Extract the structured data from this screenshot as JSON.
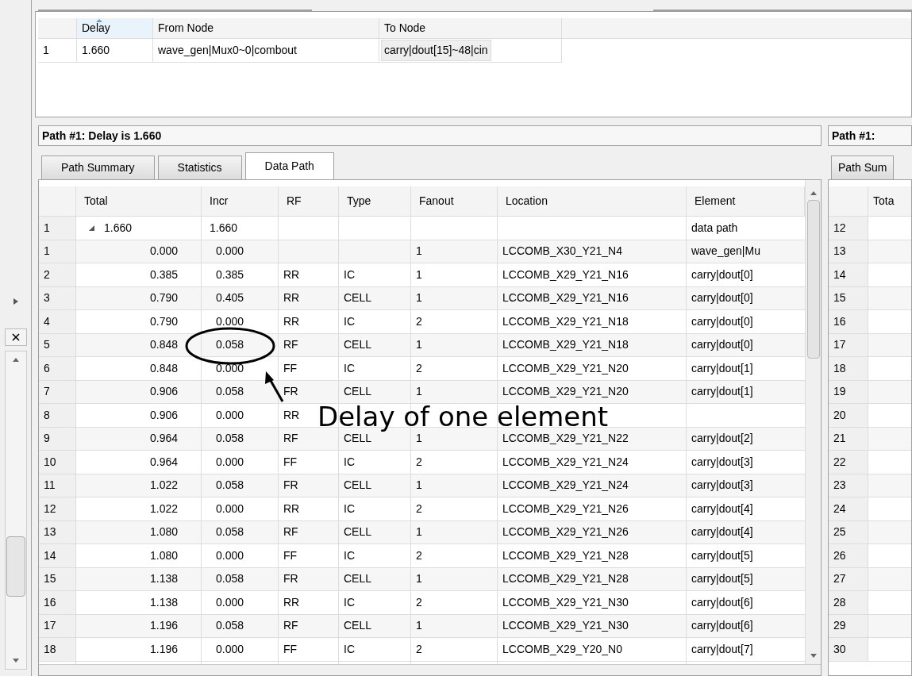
{
  "top_table": {
    "columns": [
      {
        "sorted": false
      },
      {
        "label": "Delay",
        "sorted": true
      },
      {
        "label": "From Node",
        "sorted": false
      },
      {
        "label": "To Node",
        "sorted": false
      }
    ],
    "rows": [
      {
        "cells": [
          "1",
          "1.660",
          "wave_gen|Mux0~0|combout",
          "carry|dout[15]~48|cin"
        ]
      }
    ]
  },
  "path_panel": {
    "title": "Path #1: Delay is 1.660",
    "tabs": [
      {
        "label": "Path Summary",
        "selected": false
      },
      {
        "label": "Statistics",
        "selected": false
      },
      {
        "label": "Data Path",
        "selected": true
      }
    ],
    "columns": [
      "Total",
      "Incr",
      "RF",
      "Type",
      "Fanout",
      "Location",
      "Element"
    ],
    "rows": [
      {
        "num": "1",
        "total": "1.660",
        "incr": "1.660",
        "element": "data path",
        "expanded": true,
        "children": [
          {
            "num": "1",
            "total": "0.000",
            "incr": "0.000",
            "fanout": "1",
            "location": "LCCOMB_X30_Y21_N4",
            "element": "wave_gen|Mu"
          },
          {
            "num": "2",
            "total": "0.385",
            "incr": "0.385",
            "rf": "RR",
            "type": "IC",
            "fanout": "1",
            "location": "LCCOMB_X29_Y21_N16",
            "element": "carry|dout[0]"
          },
          {
            "num": "3",
            "total": "0.790",
            "incr": "0.405",
            "rf": "RR",
            "type": "CELL",
            "fanout": "1",
            "location": "LCCOMB_X29_Y21_N16",
            "element": "carry|dout[0]"
          },
          {
            "num": "4",
            "total": "0.790",
            "incr": "0.000",
            "rf": "RR",
            "type": "IC",
            "fanout": "2",
            "location": "LCCOMB_X29_Y21_N18",
            "element": "carry|dout[0]"
          },
          {
            "num": "5",
            "total": "0.848",
            "incr": "0.058",
            "rf": "RF",
            "type": "CELL",
            "fanout": "1",
            "location": "LCCOMB_X29_Y21_N18",
            "element": "carry|dout[0]"
          },
          {
            "num": "6",
            "total": "0.848",
            "incr": "0.000",
            "rf": "FF",
            "type": "IC",
            "fanout": "2",
            "location": "LCCOMB_X29_Y21_N20",
            "element": "carry|dout[1]"
          },
          {
            "num": "7",
            "total": "0.906",
            "incr": "0.058",
            "rf": "FR",
            "type": "CELL",
            "fanout": "1",
            "location": "LCCOMB_X29_Y21_N20",
            "element": "carry|dout[1]"
          },
          {
            "num": "8",
            "total": "0.906",
            "incr": "0.000",
            "rf": "RR"
          },
          {
            "num": "9",
            "total": "0.964",
            "incr": "0.058",
            "rf": "RF",
            "type": "CELL",
            "fanout": "1",
            "location": "LCCOMB_X29_Y21_N22",
            "element": "carry|dout[2]"
          },
          {
            "num": "10",
            "total": "0.964",
            "incr": "0.000",
            "rf": "FF",
            "type": "IC",
            "fanout": "2",
            "location": "LCCOMB_X29_Y21_N24",
            "element": "carry|dout[3]"
          },
          {
            "num": "11",
            "total": "1.022",
            "incr": "0.058",
            "rf": "FR",
            "type": "CELL",
            "fanout": "1",
            "location": "LCCOMB_X29_Y21_N24",
            "element": "carry|dout[3]"
          },
          {
            "num": "12",
            "total": "1.022",
            "incr": "0.000",
            "rf": "RR",
            "type": "IC",
            "fanout": "2",
            "location": "LCCOMB_X29_Y21_N26",
            "element": "carry|dout[4]"
          },
          {
            "num": "13",
            "total": "1.080",
            "incr": "0.058",
            "rf": "RF",
            "type": "CELL",
            "fanout": "1",
            "location": "LCCOMB_X29_Y21_N26",
            "element": "carry|dout[4]"
          },
          {
            "num": "14",
            "total": "1.080",
            "incr": "0.000",
            "rf": "FF",
            "type": "IC",
            "fanout": "2",
            "location": "LCCOMB_X29_Y21_N28",
            "element": "carry|dout[5]"
          },
          {
            "num": "15",
            "total": "1.138",
            "incr": "0.058",
            "rf": "FR",
            "type": "CELL",
            "fanout": "1",
            "location": "LCCOMB_X29_Y21_N28",
            "element": "carry|dout[5]"
          },
          {
            "num": "16",
            "total": "1.138",
            "incr": "0.000",
            "rf": "RR",
            "type": "IC",
            "fanout": "2",
            "location": "LCCOMB_X29_Y21_N30",
            "element": "carry|dout[6]"
          },
          {
            "num": "17",
            "total": "1.196",
            "incr": "0.058",
            "rf": "RF",
            "type": "CELL",
            "fanout": "1",
            "location": "LCCOMB_X29_Y21_N30",
            "element": "carry|dout[6]"
          },
          {
            "num": "18",
            "total": "1.196",
            "incr": "0.000",
            "rf": "FF",
            "type": "IC",
            "fanout": "2",
            "location": "LCCOMB_X29_Y20_N0",
            "element": "carry|dout[7]"
          }
        ]
      }
    ]
  },
  "side_panel": {
    "title": "Path #1:",
    "tab": "Path Sum",
    "column": "Tota",
    "rows": [
      "12",
      "13",
      "14",
      "15",
      "16",
      "17",
      "18",
      "19",
      "20",
      "21",
      "22",
      "23",
      "24",
      "25",
      "26",
      "27",
      "28",
      "29",
      "30"
    ]
  },
  "annotation": {
    "text": "Delay of one element"
  }
}
